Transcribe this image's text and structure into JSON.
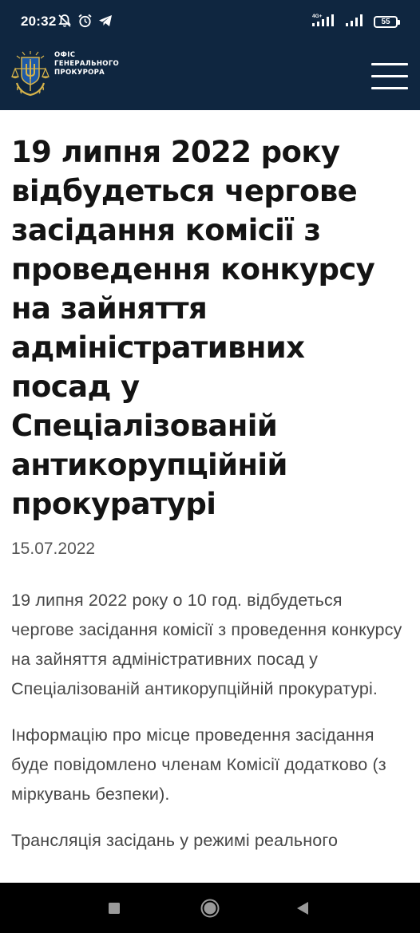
{
  "status_bar": {
    "time": "20:32",
    "left_icons": [
      "muted-bell-icon",
      "alarm-icon",
      "telegram-icon"
    ],
    "network_label": "4G+",
    "battery_level": "55"
  },
  "header": {
    "org_name_lines": [
      "ОФІС",
      "ГЕНЕРАЛЬНОГО",
      "ПРОКУРОРА"
    ],
    "logo_icon": "prosecutor-emblem-icon",
    "menu_icon": "hamburger-menu-icon",
    "colors": {
      "background": "#0f2640",
      "logo_gold": "#d6b34a"
    }
  },
  "article": {
    "title": "19 липня 2022 року відбудеться чергове засідання комісії з проведення конкурсу на зайняття адміністративних посад у Спеціалізованій антикорупційній прокуратурі",
    "date": "15.07.2022",
    "paragraphs": [
      "19 липня 2022 року о 10 год. відбудеться чергове засідання комісії з проведення конкурсу на зайняття адміністративних посад у Спеціалізованій антикорупційній прокуратурі.",
      "Інформацію про місце проведення засідання буде повідомлено членам Комісії додатково (з міркувань безпеки).",
      "Трансляція засідань у режимі реального"
    ]
  },
  "nav_bar": {
    "buttons": [
      "recents-square-icon",
      "home-circle-icon",
      "back-triangle-icon"
    ]
  }
}
